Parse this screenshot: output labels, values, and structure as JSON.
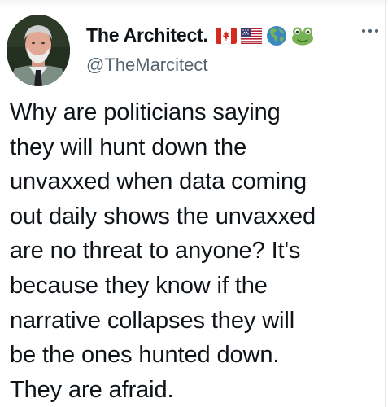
{
  "tweet": {
    "author": {
      "display_name": "The Architect.",
      "handle": "@TheMarcitect",
      "avatar": "profile-photo",
      "name_emojis": [
        "canada-flag-icon",
        "us-flag-icon",
        "globe-americas-icon",
        "frog-icon"
      ]
    },
    "more_icon": "more-horizontal-icon",
    "text": "Why are politicians saying\nthey will hunt down the\nunvaxxed when data coming\nout daily shows the unvaxxed\nare no threat to anyone? It's\nbecause they know if the\nnarrative collapses they will\nbe the ones hunted down.\nThey are afraid."
  },
  "colors": {
    "text_primary": "#0f1419",
    "text_secondary": "#536471",
    "background": "#ffffff"
  }
}
